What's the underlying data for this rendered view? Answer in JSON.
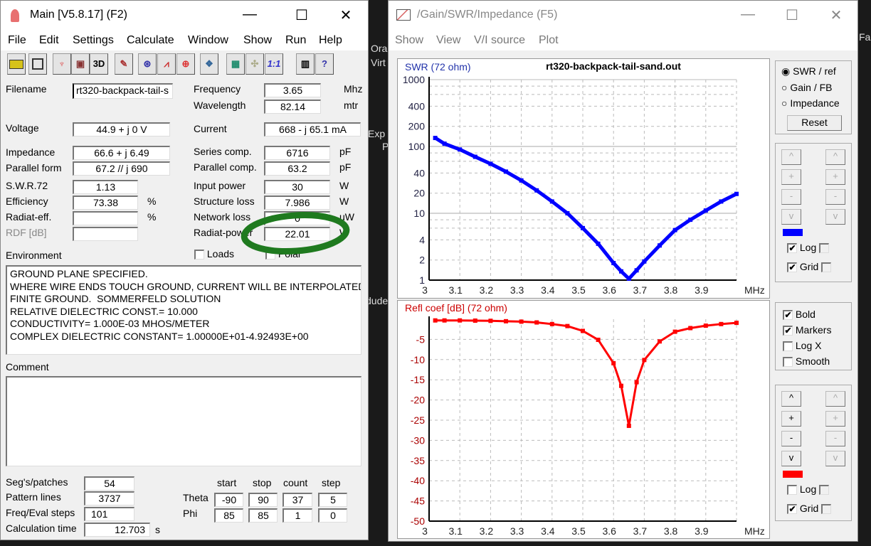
{
  "desktop": {
    "fragments": [
      "Ora",
      "Virt",
      "Exp",
      "P",
      "dude",
      "Fa"
    ]
  },
  "main": {
    "title": "Main [V5.8.17]  (F2)",
    "controls": {
      "minimize": "—",
      "maximize": "☐",
      "close": "✕"
    },
    "menu": [
      "File",
      "Edit",
      "Settings",
      "Calculate",
      "Window",
      "Show",
      "Run",
      "Help"
    ],
    "toolbar": [
      "open-folder",
      "save",
      "antenna",
      "cube",
      "3D",
      "edit",
      "pattern",
      "swr-chart",
      "smith",
      "optimize",
      "calculator",
      "match",
      "1:1",
      "book",
      "help"
    ],
    "toolbar_3d": "3D",
    "toolbar_11": "1:1",
    "toolbar_help": "?",
    "fields": {
      "filename": {
        "label": "Filename",
        "value": "rt320-backpack-tail-s"
      },
      "frequency": {
        "label": "Frequency",
        "value": "3.65",
        "unit": "Mhz"
      },
      "wavelength": {
        "label": "Wavelength",
        "value": "82.14",
        "unit": "mtr"
      },
      "voltage": {
        "label": "Voltage",
        "value": "44.9 + j 0 V"
      },
      "current": {
        "label": "Current",
        "value": "668 - j 65.1 mA"
      },
      "impedance": {
        "label": "Impedance",
        "value": "66.6 + j 6.49"
      },
      "series_comp": {
        "label": "Series comp.",
        "value": "6716",
        "unit": "pF"
      },
      "parallel_form": {
        "label": "Parallel form",
        "value": "67.2 // j 690"
      },
      "parallel_comp": {
        "label": "Parallel comp.",
        "value": "63.2",
        "unit": "pF"
      },
      "swr": {
        "label": "S.W.R.72",
        "value": "1.13"
      },
      "input_power": {
        "label": "Input power",
        "value": "30",
        "unit": "W"
      },
      "efficiency": {
        "label": "Efficiency",
        "value": "73.38",
        "unit": "%"
      },
      "structure_loss": {
        "label": "Structure loss",
        "value": "7.986",
        "unit": "W"
      },
      "radiat_eff": {
        "label": "Radiat-eff.",
        "value": "",
        "unit": "%"
      },
      "network_loss": {
        "label": "Network loss",
        "value": "0",
        "unit": "uW"
      },
      "rdf": {
        "label": "RDF [dB]",
        "value": ""
      },
      "radiat_power": {
        "label": "Radiat-power",
        "value": "22.01",
        "unit": "W"
      }
    },
    "environment_label": "Environment",
    "loads_label": "Loads",
    "polar_label": "Polar",
    "environment_text": "GROUND PLANE SPECIFIED.\nWHERE WIRE ENDS TOUCH GROUND, CURRENT WILL BE INTERPOLATED\nFINITE GROUND.  SOMMERFELD SOLUTION\nRELATIVE DIELECTRIC CONST.= 10.000\nCONDUCTIVITY= 1.000E-03 MHOS/METER\nCOMPLEX DIELECTRIC CONSTANT= 1.00000E+01-4.92493E+00",
    "comment_label": "Comment",
    "comment_text": "",
    "segs": {
      "label": "Seg's/patches",
      "value": "54"
    },
    "pattern_lines": {
      "label": "Pattern lines",
      "value": "3737"
    },
    "freq_steps": {
      "label": "Freq/Eval steps",
      "value": "101"
    },
    "calc_time": {
      "label": "Calculation time",
      "value": "12.703",
      "unit": "s"
    },
    "pattern_headers": [
      "start",
      "stop",
      "count",
      "step"
    ],
    "theta": {
      "label": "Theta",
      "values": [
        "-90",
        "90",
        "37",
        "5"
      ]
    },
    "phi": {
      "label": "Phi",
      "values": [
        "85",
        "85",
        "1",
        "0"
      ]
    },
    "annotation_color": "#1f7a1f"
  },
  "plot": {
    "title": "/Gain/SWR/Impedance (F5)",
    "controls": {
      "minimize": "—",
      "maximize": "☐",
      "close": "✕"
    },
    "menu": [
      "Show",
      "View",
      "V/I source",
      "Plot"
    ],
    "mode": {
      "options": [
        "SWR / ref",
        "Gain / FB",
        "Impedance"
      ],
      "selected": 0,
      "reset": "Reset"
    },
    "axis_buttons": [
      "^",
      "+",
      "-",
      "v"
    ],
    "log_label": "Log",
    "grid_label": "Grid",
    "top_axis": {
      "color": "#0000ff",
      "log": true,
      "grid": true
    },
    "bottom_axis": {
      "color": "#ff0000",
      "log": false,
      "grid": true
    },
    "options": [
      {
        "label": "Bold",
        "checked": true
      },
      {
        "label": "Markers",
        "checked": true
      },
      {
        "label": "Log X",
        "checked": false
      },
      {
        "label": "Smooth",
        "checked": false
      }
    ],
    "check_mark": "✔"
  },
  "chart_data": [
    {
      "type": "line",
      "title": "rt320-backpack-tail-sand.out",
      "ylabel": "SWR (72 ohm)",
      "xlabel": "MHz",
      "color": "#0000ff",
      "yscale": "log",
      "ylim": [
        1,
        1000
      ],
      "xlim": [
        3,
        4
      ],
      "grid": true,
      "yticks": [
        "1000",
        "400",
        "200",
        "100",
        "40",
        "20",
        "10",
        "4",
        "2",
        "1"
      ],
      "xticks": [
        "3",
        "3.1",
        "3.2",
        "3.3",
        "3.4",
        "3.5",
        "3.6",
        "3.7",
        "3.8",
        "3.9"
      ],
      "x": [
        3.02,
        3.05,
        3.1,
        3.15,
        3.2,
        3.25,
        3.3,
        3.35,
        3.4,
        3.45,
        3.5,
        3.55,
        3.6,
        3.625,
        3.65,
        3.675,
        3.7,
        3.75,
        3.8,
        3.85,
        3.9,
        3.95,
        4.0
      ],
      "y": [
        134,
        110,
        90,
        70,
        55,
        42,
        31,
        22,
        15,
        10,
        6,
        3.5,
        1.8,
        1.35,
        1.05,
        1.4,
        1.9,
        3.3,
        5.6,
        8,
        11,
        15,
        19.5
      ]
    },
    {
      "type": "line",
      "title": "",
      "ylabel": "Refl coef [dB] (72 ohm)",
      "xlabel": "MHz",
      "color": "#ff0000",
      "yscale": "linear",
      "ylim": [
        -50,
        0
      ],
      "xlim": [
        3,
        4
      ],
      "grid": true,
      "yticks": [
        "-5",
        "-10",
        "-15",
        "-20",
        "-25",
        "-30",
        "-35",
        "-40",
        "-45",
        "-50"
      ],
      "xticks": [
        "3",
        "3.1",
        "3.2",
        "3.3",
        "3.4",
        "3.5",
        "3.6",
        "3.7",
        "3.8",
        "3.9"
      ],
      "x": [
        3.02,
        3.05,
        3.1,
        3.15,
        3.2,
        3.25,
        3.3,
        3.35,
        3.4,
        3.45,
        3.5,
        3.55,
        3.6,
        3.625,
        3.65,
        3.675,
        3.7,
        3.75,
        3.8,
        3.85,
        3.9,
        3.95,
        4.0
      ],
      "y": [
        -0.3,
        -0.3,
        -0.3,
        -0.35,
        -0.4,
        -0.5,
        -0.6,
        -0.8,
        -1.2,
        -1.7,
        -2.9,
        -5.1,
        -10.9,
        -16.5,
        -26.4,
        -15.6,
        -10.1,
        -5.5,
        -3.1,
        -2.2,
        -1.6,
        -1.2,
        -0.9
      ]
    }
  ]
}
